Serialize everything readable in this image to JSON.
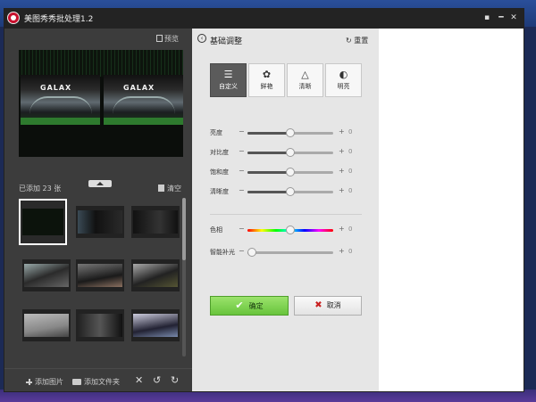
{
  "window": {
    "title": "美图秀秀批处理1.2"
  },
  "titlebar_buttons": {
    "menu": "▪",
    "minimize": "━",
    "maximize": "□",
    "close": "✕"
  },
  "left": {
    "preview_label": "预览",
    "preview_brand": "GALAX",
    "added_count_label": "已添加 23 张",
    "clear_label": "清空",
    "add_image_label": "添加图片",
    "add_folder_label": "添加文件夹"
  },
  "panel": {
    "title": "基础调整",
    "reset_label": "重置",
    "modes": [
      {
        "label": "自定义",
        "icon": "sliders-icon"
      },
      {
        "label": "鲜艳",
        "icon": "flower-icon"
      },
      {
        "label": "清晰",
        "icon": "triangle-icon"
      },
      {
        "label": "明亮",
        "icon": "contrast-icon"
      }
    ],
    "sliders": [
      {
        "label": "亮度",
        "value": "0",
        "level": 0.5
      },
      {
        "label": "对比度",
        "value": "0",
        "level": 0.5
      },
      {
        "label": "饱和度",
        "value": "0",
        "level": 0.5
      },
      {
        "label": "清晰度",
        "value": "0",
        "level": 0.5
      }
    ],
    "sliders2": [
      {
        "label": "色相",
        "value": "0",
        "level": 0.5,
        "hue": true
      },
      {
        "label": "智能补光",
        "value": "0",
        "level": 0.05
      }
    ],
    "ok_label": "确定",
    "cancel_label": "取消"
  },
  "colors": {
    "ok_green": "#68c43c",
    "cancel_red": "#c82020"
  }
}
